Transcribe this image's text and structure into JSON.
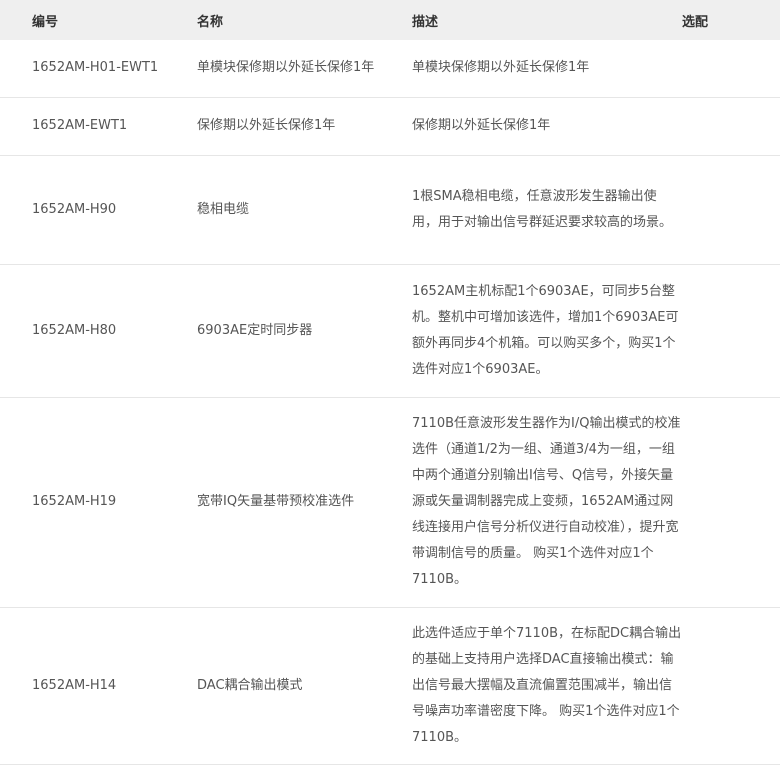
{
  "headers": {
    "code": "编号",
    "name": "名称",
    "desc": "描述",
    "option": "选配"
  },
  "rows": [
    {
      "code": "1652AM-H01-EWT1",
      "name": "单模块保修期以外延长保修1年",
      "desc": "单模块保修期以外延长保修1年",
      "option": ""
    },
    {
      "code": "1652AM-EWT1",
      "name": "保修期以外延长保修1年",
      "desc": "保修期以外延长保修1年",
      "option": ""
    },
    {
      "code": "1652AM-H90",
      "name": "稳相电缆",
      "desc": "1根SMA稳相电缆，任意波形发生器输出使用，用于对输出信号群延迟要求较高的场景。",
      "option": ""
    },
    {
      "code": "1652AM-H80",
      "name": "6903AE定时同步器",
      "desc": "1652AM主机标配1个6903AE，可同步5台整机。整机中可增加该选件，增加1个6903AE可额外再同步4个机箱。可以购买多个，购买1个选件对应1个6903AE。",
      "option": ""
    },
    {
      "code": "1652AM-H19",
      "name": "宽带IQ矢量基带预校准选件",
      "desc": "7110B任意波形发生器作为I/Q输出模式的校准选件（通道1/2为一组、通道3/4为一组，一组中两个通道分别输出I信号、Q信号，外接矢量源或矢量调制器完成上变频，1652AM通过网线连接用户信号分析仪进行自动校准），提升宽带调制信号的质量。 购买1个选件对应1个7110B。",
      "option": ""
    },
    {
      "code": "1652AM-H14",
      "name": "DAC耦合输出模式",
      "desc": "此选件适应于单个7110B，在标配DC耦合输出的基础上支持用户选择DAC直接输出模式：输出信号最大摆幅及直流偏置范围减半，输出信号噪声功率谱密度下降。 购买1个选件对应1个7110B。",
      "option": ""
    }
  ]
}
